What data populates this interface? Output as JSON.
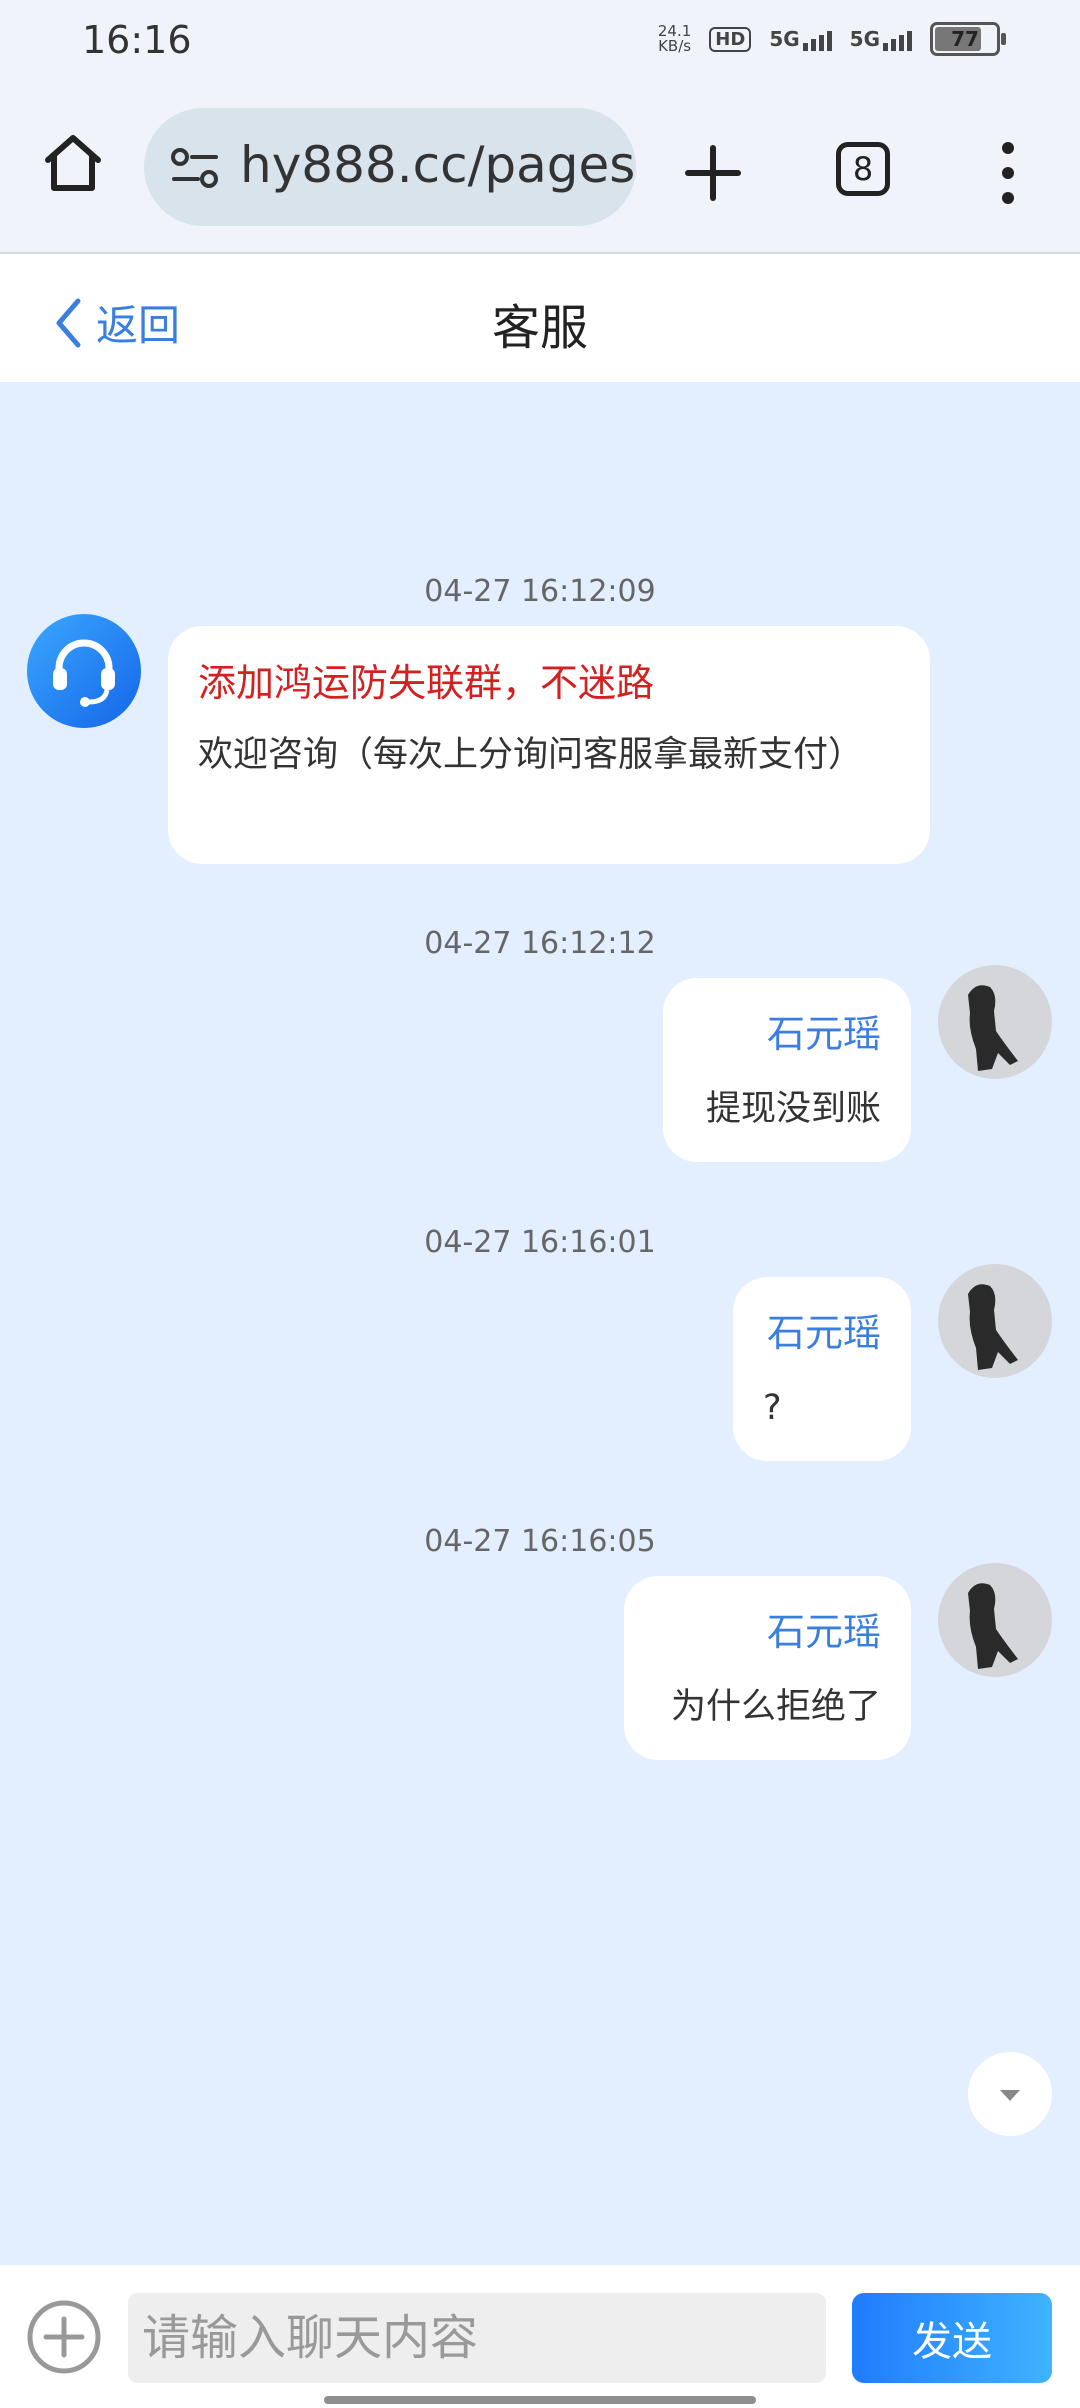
{
  "status_bar": {
    "time": "16:16",
    "net_speed_value": "24.1",
    "net_speed_unit": "KB/s",
    "hd_label": "HD",
    "signal1": "5G",
    "signal2": "5G",
    "battery": "77"
  },
  "browser": {
    "url": "hy888.cc/pages",
    "tab_count": "8"
  },
  "header": {
    "back_label": "返回",
    "title": "客服"
  },
  "messages": [
    {
      "timestamp": "04-27 16:12:09",
      "sender": "cs",
      "title": "添加鸿运防失联群，不迷路",
      "text": "欢迎咨询（每次上分询问客服拿最新支付）"
    },
    {
      "timestamp": "04-27 16:12:12",
      "sender": "user",
      "name": "石元瑶",
      "text": "提现没到账"
    },
    {
      "timestamp": "04-27 16:16:01",
      "sender": "user",
      "name": "石元瑶",
      "text": "?"
    },
    {
      "timestamp": "04-27 16:16:05",
      "sender": "user",
      "name": "石元瑶",
      "text": "为什么拒绝了"
    }
  ],
  "input": {
    "placeholder": "请输入聊天内容",
    "send_label": "发送"
  },
  "colors": {
    "accent": "#3a7ee0",
    "highlight_text": "#d32020",
    "chat_background": "#e3efff",
    "send_button": "#1f7cff"
  }
}
